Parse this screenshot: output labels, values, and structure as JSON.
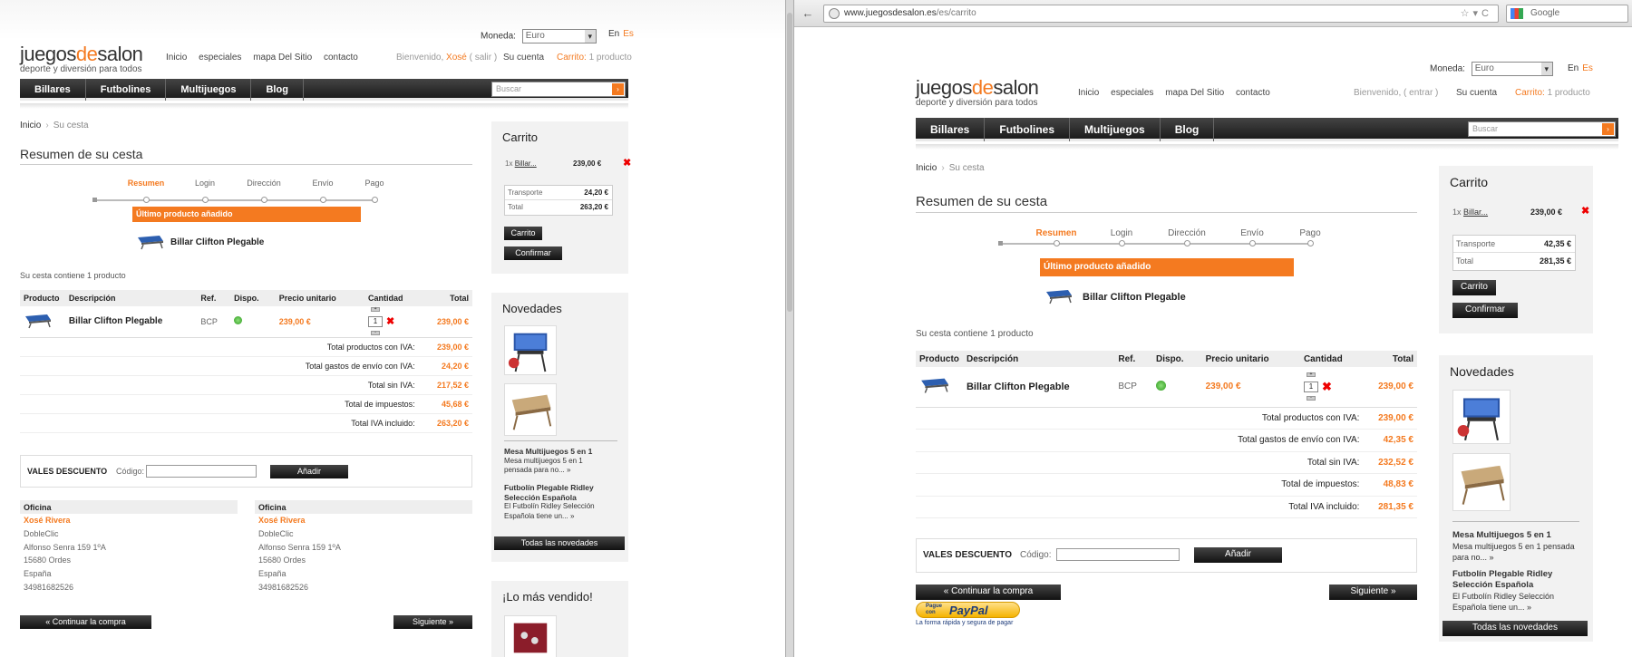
{
  "left": {
    "moneda_label": "Moneda:",
    "moneda_value": "Euro",
    "lang_en": "En",
    "lang_es": "Es",
    "logo_a": "juegos",
    "logo_b": "de",
    "logo_c": "salon",
    "logo_tag": "deporte y diversión para todos",
    "toplinks": [
      "Inicio",
      "especiales",
      "mapa Del Sitio",
      "contacto"
    ],
    "welcome_pre": "Bienvenido,",
    "welcome_name": "Xosé",
    "welcome_post": "( salir )",
    "cuenta": "Su cuenta",
    "carrito_label": "Carrito:",
    "carrito_count": "1 producto",
    "menu": [
      "Billares",
      "Futbolines",
      "Multijuegos",
      "Blog"
    ],
    "search_ph": "Buscar",
    "crumb_home": "Inicio",
    "crumb_sep": "›",
    "crumb_cur": "Su cesta",
    "title": "Resumen de su cesta",
    "steps": [
      "Resumen",
      "Login",
      "Dirección",
      "Envío",
      "Pago"
    ],
    "last_added": "Último producto añadido",
    "added_product": "Billar Clifton Plegable",
    "contains": "Su cesta contiene 1 producto",
    "table_headers": [
      "Producto",
      "Descripción",
      "Ref.",
      "Dispo.",
      "Precio unitario",
      "Cantidad",
      "Total"
    ],
    "row": {
      "desc": "Billar Clifton Plegable",
      "ref": "BCP",
      "price": "239,00 €",
      "qty": "1",
      "total": "239,00 €"
    },
    "sums": [
      {
        "label": "Total productos con IVA:",
        "value": "239,00 €"
      },
      {
        "label": "Total gastos de envío con IVA:",
        "value": "24,20 €"
      },
      {
        "label": "Total sin IVA:",
        "value": "217,52 €"
      },
      {
        "label": "Total de impuestos:",
        "value": "45,68 €"
      },
      {
        "label": "Total IVA incluido:",
        "value": "263,20 €"
      }
    ],
    "vales_label": "VALES DESCUENTO",
    "codigo_label": "Código:",
    "anadir": "Añadir",
    "addr1": {
      "head": "Oficina",
      "name": "Xosé Rivera",
      "lines": [
        "DobleClic",
        "Alfonso Senra 159 1ºA",
        "15680 Ordes",
        "España",
        "34981682526"
      ]
    },
    "addr2": {
      "head": "Oficina",
      "name": "Xosé Rivera",
      "lines": [
        "DobleClic",
        "Alfonso Senra 159 1ºA",
        "15680 Ordes",
        "España",
        "34981682526"
      ]
    },
    "continuar": "« Continuar la compra",
    "siguiente": "Siguiente »",
    "side_cart_title": "Carrito",
    "side_cart_qty": "1x",
    "side_cart_item": "Billar...",
    "side_cart_price": "239,00 €",
    "side_transporte_label": "Transporte",
    "side_transporte": "24,20 €",
    "side_total_label": "Total",
    "side_total": "263,20 €",
    "side_carrito_btn": "Carrito",
    "side_confirmar_btn": "Confirmar",
    "novedades_title": "Novedades",
    "nov1_title": "Mesa Multijuegos 5 en 1",
    "nov1_desc": [
      "Mesa multijuegos 5 en 1",
      "pensada para no... »"
    ],
    "nov2_title": [
      "Futbolín Plegable Ridley",
      "Selección Española"
    ],
    "nov2_desc": [
      "El Futbolín Ridley Selección",
      "Española  tiene un... »"
    ],
    "todas": "Todas las novedades",
    "mas_vendido": "¡Lo más vendido!"
  },
  "right": {
    "url_domain": "www.juegosdesalon.es",
    "url_path": "/es/carrito",
    "google_ph": "Google",
    "moneda_label": "Moneda:",
    "moneda_value": "Euro",
    "lang_en": "En",
    "lang_es": "Es",
    "logo_a": "juegos",
    "logo_b": "de",
    "logo_c": "salon",
    "logo_tag": "deporte y diversión para todos",
    "toplinks": [
      "Inicio",
      "especiales",
      "mapa Del Sitio",
      "contacto"
    ],
    "welcome": "Bienvenido, ( entrar )",
    "cuenta": "Su cuenta",
    "carrito_label": "Carrito:",
    "carrito_count": "1 producto",
    "menu": [
      "Billares",
      "Futbolines",
      "Multijuegos",
      "Blog"
    ],
    "search_ph": "Buscar",
    "crumb_home": "Inicio",
    "crumb_sep": "›",
    "crumb_cur": "Su cesta",
    "title": "Resumen de su cesta",
    "steps": [
      "Resumen",
      "Login",
      "Dirección",
      "Envío",
      "Pago"
    ],
    "last_added": "Último producto añadido",
    "added_product": "Billar Clifton Plegable",
    "contains": "Su cesta contiene 1 producto",
    "table_headers": [
      "Producto",
      "Descripción",
      "Ref.",
      "Dispo.",
      "Precio unitario",
      "Cantidad",
      "Total"
    ],
    "row": {
      "desc": "Billar Clifton Plegable",
      "ref": "BCP",
      "price": "239,00 €",
      "qty": "1",
      "total": "239,00 €"
    },
    "sums": [
      {
        "label": "Total productos con IVA:",
        "value": "239,00 €"
      },
      {
        "label": "Total gastos de envío con IVA:",
        "value": "42,35 €"
      },
      {
        "label": "Total sin IVA:",
        "value": "232,52 €"
      },
      {
        "label": "Total de impuestos:",
        "value": "48,83 €"
      },
      {
        "label": "Total IVA incluido:",
        "value": "281,35 €"
      }
    ],
    "vales_label": "VALES DESCUENTO",
    "codigo_label": "Código:",
    "anadir": "Añadir",
    "continuar": "« Continuar la compra",
    "siguiente": "Siguiente »",
    "paypal_top": "Pague con",
    "paypal_word": "PayPal",
    "paypal_sub": "La forma rápida y segura de pagar",
    "side_cart_title": "Carrito",
    "side_cart_qty": "1x",
    "side_cart_item": "Billar...",
    "side_cart_price": "239,00 €",
    "side_transporte_label": "Transporte",
    "side_transporte": "42,35 €",
    "side_total_label": "Total",
    "side_total": "281,35 €",
    "side_carrito_btn": "Carrito",
    "side_confirmar_btn": "Confirmar",
    "novedades_title": "Novedades",
    "nov1_title": "Mesa Multijuegos 5 en 1",
    "nov1_desc": [
      "Mesa multijuegos 5 en 1 pensada",
      "para no... »"
    ],
    "nov2_title": [
      "Futbolín Plegable Ridley",
      "Selección Española"
    ],
    "nov2_desc": [
      "El Futbolín Ridley Selección",
      "Española  tiene un... »"
    ],
    "todas": "Todas las novedades"
  },
  "colors": {
    "accent": "#f47a20",
    "menu": "#222222",
    "panel": "#f2f2f2",
    "remove": "#e00000",
    "available": "#2c9a1c"
  }
}
